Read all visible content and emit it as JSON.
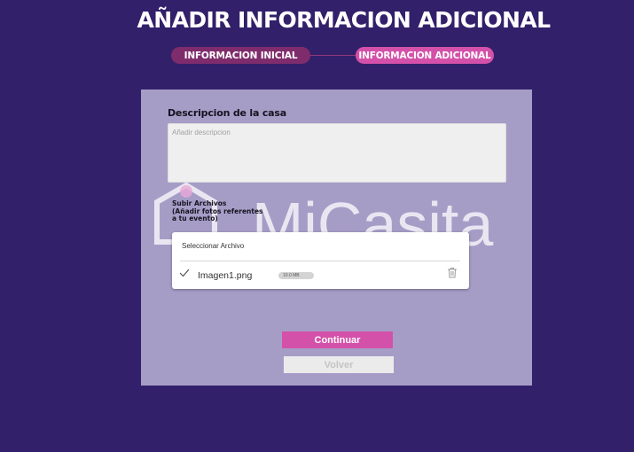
{
  "header": {
    "title": "AÑADIR INFORMACION ADICIONAL"
  },
  "steps": [
    {
      "label": "INFORMACION INICIAL"
    },
    {
      "label": "INFORMACION ADICIONAL"
    }
  ],
  "form": {
    "description_label": "Descripcion de la casa",
    "description_placeholder": "Añadir descripcion",
    "upload_label": "Subir Archivos\n(Añadir fotos referentes a tu evento)",
    "select_file": "Seleccionar Archivo",
    "file": {
      "name": "Imagen1.png",
      "size": "10.0 MB"
    }
  },
  "buttons": {
    "continue": "Continuar",
    "back": "Volver"
  },
  "watermark": {
    "brand": "MiCasita"
  },
  "colors": {
    "background": "#33206a",
    "accent": "#d451a9",
    "step_inactive": "#7f2c6c",
    "card": "#a69dc7"
  }
}
